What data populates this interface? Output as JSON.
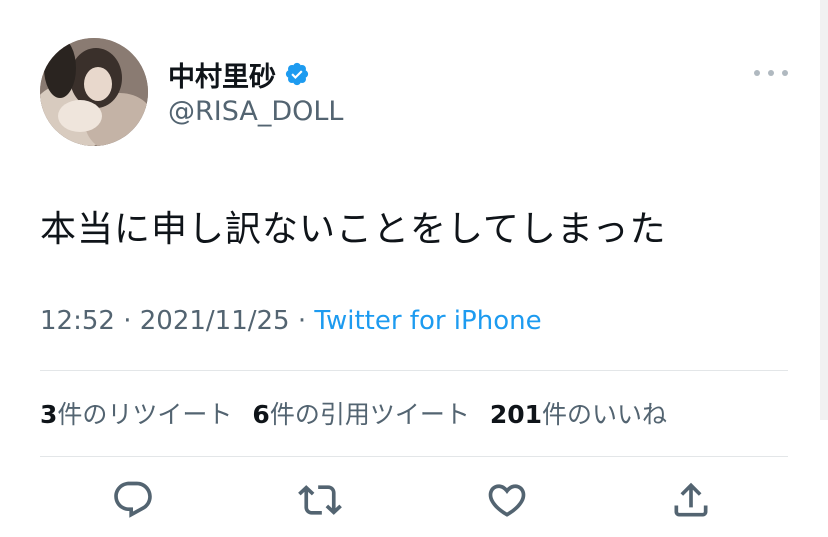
{
  "author": {
    "display_name": "中村里砂",
    "handle": "@RISA_DOLL",
    "verified": true
  },
  "tweet": {
    "text": "本当に申し訳ないことをしてしまった",
    "time": "12:52",
    "date": "2021/11/25",
    "source": "Twitter for iPhone"
  },
  "stats": {
    "retweets_count": "3",
    "retweets_label": "件のリツイート",
    "quotes_count": "6",
    "quotes_label": "件の引用ツイート",
    "likes_count": "201",
    "likes_label": "件のいいね"
  },
  "actions": {
    "reply": "reply-icon",
    "retweet": "retweet-icon",
    "like": "heart-icon",
    "share": "share-icon"
  },
  "colors": {
    "accent": "#1d9bf0",
    "secondary_text": "#536471",
    "primary_text": "#0f1419"
  }
}
